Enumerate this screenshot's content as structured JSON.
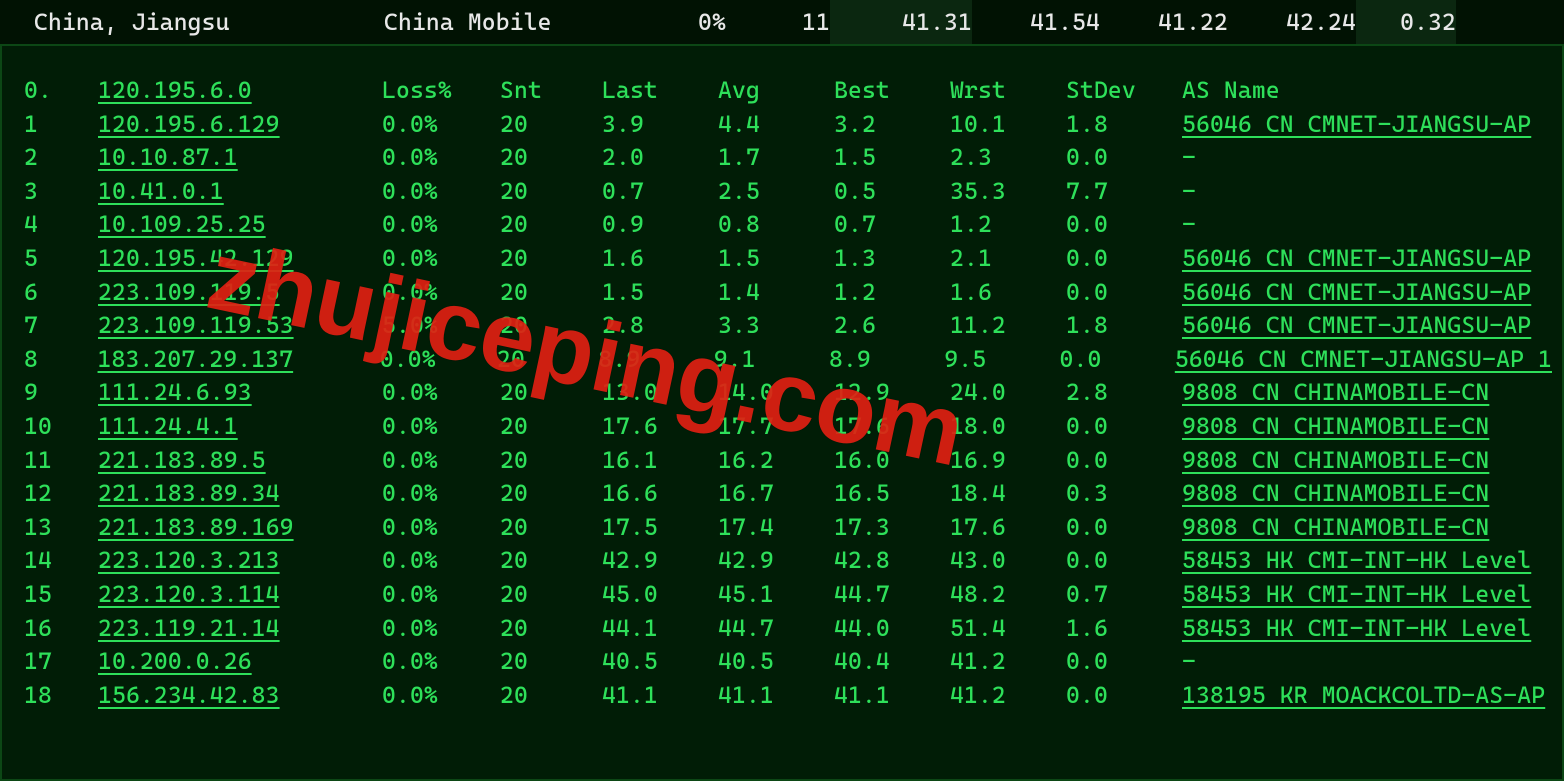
{
  "top": {
    "location": "China, Jiangsu",
    "isp": "China Mobile",
    "loss": "0%",
    "snt": "11",
    "last": "41.31",
    "avg": "41.54",
    "best": "41.22",
    "wrst": "42.24",
    "stdev": "0.32"
  },
  "headers": {
    "hop": "0.",
    "ip": "120.195.6.0",
    "loss": "Loss%",
    "snt": "Snt",
    "last": "Last",
    "avg": "Avg",
    "best": "Best",
    "wrst": "Wrst",
    "stdev": "StDev",
    "asname": "AS Name"
  },
  "hops": [
    {
      "n": "1",
      "ip": "120.195.6.129",
      "loss": "0.0%",
      "snt": "20",
      "last": "3.9",
      "avg": "4.4",
      "best": "3.2",
      "wrst": "10.1",
      "stdev": "1.8",
      "as": "56046 CN CMNET-JIANGSU-AP"
    },
    {
      "n": "2",
      "ip": "10.10.87.1",
      "loss": "0.0%",
      "snt": "20",
      "last": "2.0",
      "avg": "1.7",
      "best": "1.5",
      "wrst": "2.3",
      "stdev": "0.0",
      "as": "-"
    },
    {
      "n": "3",
      "ip": "10.41.0.1",
      "loss": "0.0%",
      "snt": "20",
      "last": "0.7",
      "avg": "2.5",
      "best": "0.5",
      "wrst": "35.3",
      "stdev": "7.7",
      "as": "-"
    },
    {
      "n": "4",
      "ip": "10.109.25.25",
      "loss": "0.0%",
      "snt": "20",
      "last": "0.9",
      "avg": "0.8",
      "best": "0.7",
      "wrst": "1.2",
      "stdev": "0.0",
      "as": "-"
    },
    {
      "n": "5",
      "ip": "120.195.42.129",
      "loss": "0.0%",
      "snt": "20",
      "last": "1.6",
      "avg": "1.5",
      "best": "1.3",
      "wrst": "2.1",
      "stdev": "0.0",
      "as": "56046 CN CMNET-JIANGSU-AP"
    },
    {
      "n": "6",
      "ip": "223.109.119.5",
      "loss": "0.0%",
      "snt": "20",
      "last": "1.5",
      "avg": "1.4",
      "best": "1.2",
      "wrst": "1.6",
      "stdev": "0.0",
      "as": "56046 CN CMNET-JIANGSU-AP"
    },
    {
      "n": "7",
      "ip": "223.109.119.53",
      "loss": "5.0%",
      "snt": "20",
      "last": "2.8",
      "avg": "3.3",
      "best": "2.6",
      "wrst": "11.2",
      "stdev": "1.8",
      "as": "56046 CN CMNET-JIANGSU-AP"
    },
    {
      "n": "8",
      "ip": "183.207.29.137",
      "loss": "0.0%",
      "snt": "20",
      "last": "8.9",
      "avg": "9.1",
      "best": "8.9",
      "wrst": "9.5",
      "stdev": "0.0",
      "as": "56046 CN CMNET-JIANGSU-AP 1"
    },
    {
      "n": "9",
      "ip": "111.24.6.93",
      "loss": "0.0%",
      "snt": "20",
      "last": "13.0",
      "avg": "14.0",
      "best": "12.9",
      "wrst": "24.0",
      "stdev": "2.8",
      "as": "9808  CN CHINAMOBILE-CN"
    },
    {
      "n": "10",
      "ip": "111.24.4.1",
      "loss": "0.0%",
      "snt": "20",
      "last": "17.6",
      "avg": "17.7",
      "best": "17.6",
      "wrst": "18.0",
      "stdev": "0.0",
      "as": "9808  CN CHINAMOBILE-CN"
    },
    {
      "n": "11",
      "ip": "221.183.89.5",
      "loss": "0.0%",
      "snt": "20",
      "last": "16.1",
      "avg": "16.2",
      "best": "16.0",
      "wrst": "16.9",
      "stdev": "0.0",
      "as": "9808  CN CHINAMOBILE-CN"
    },
    {
      "n": "12",
      "ip": "221.183.89.34",
      "loss": "0.0%",
      "snt": "20",
      "last": "16.6",
      "avg": "16.7",
      "best": "16.5",
      "wrst": "18.4",
      "stdev": "0.3",
      "as": "9808  CN CHINAMOBILE-CN"
    },
    {
      "n": "13",
      "ip": "221.183.89.169",
      "loss": "0.0%",
      "snt": "20",
      "last": "17.5",
      "avg": "17.4",
      "best": "17.3",
      "wrst": "17.6",
      "stdev": "0.0",
      "as": "9808  CN CHINAMOBILE-CN"
    },
    {
      "n": "14",
      "ip": "223.120.3.213",
      "loss": "0.0%",
      "snt": "20",
      "last": "42.9",
      "avg": "42.9",
      "best": "42.8",
      "wrst": "43.0",
      "stdev": "0.0",
      "as": "58453 HK CMI-INT-HK Level"
    },
    {
      "n": "15",
      "ip": "223.120.3.114",
      "loss": "0.0%",
      "snt": "20",
      "last": "45.0",
      "avg": "45.1",
      "best": "44.7",
      "wrst": "48.2",
      "stdev": "0.7",
      "as": "58453 HK CMI-INT-HK Level"
    },
    {
      "n": "16",
      "ip": "223.119.21.14",
      "loss": "0.0%",
      "snt": "20",
      "last": "44.1",
      "avg": "44.7",
      "best": "44.0",
      "wrst": "51.4",
      "stdev": "1.6",
      "as": "58453 HK CMI-INT-HK Level"
    },
    {
      "n": "17",
      "ip": "10.200.0.26",
      "loss": "0.0%",
      "snt": "20",
      "last": "40.5",
      "avg": "40.5",
      "best": "40.4",
      "wrst": "41.2",
      "stdev": "0.0",
      "as": "-"
    },
    {
      "n": "18",
      "ip": "156.234.42.83",
      "loss": "0.0%",
      "snt": "20",
      "last": "41.1",
      "avg": "41.1",
      "best": "41.1",
      "wrst": "41.2",
      "stdev": "0.0",
      "as": "138195 KR MOACKCOLTD-AS-AP"
    }
  ],
  "watermark": "zhujiceping.com"
}
